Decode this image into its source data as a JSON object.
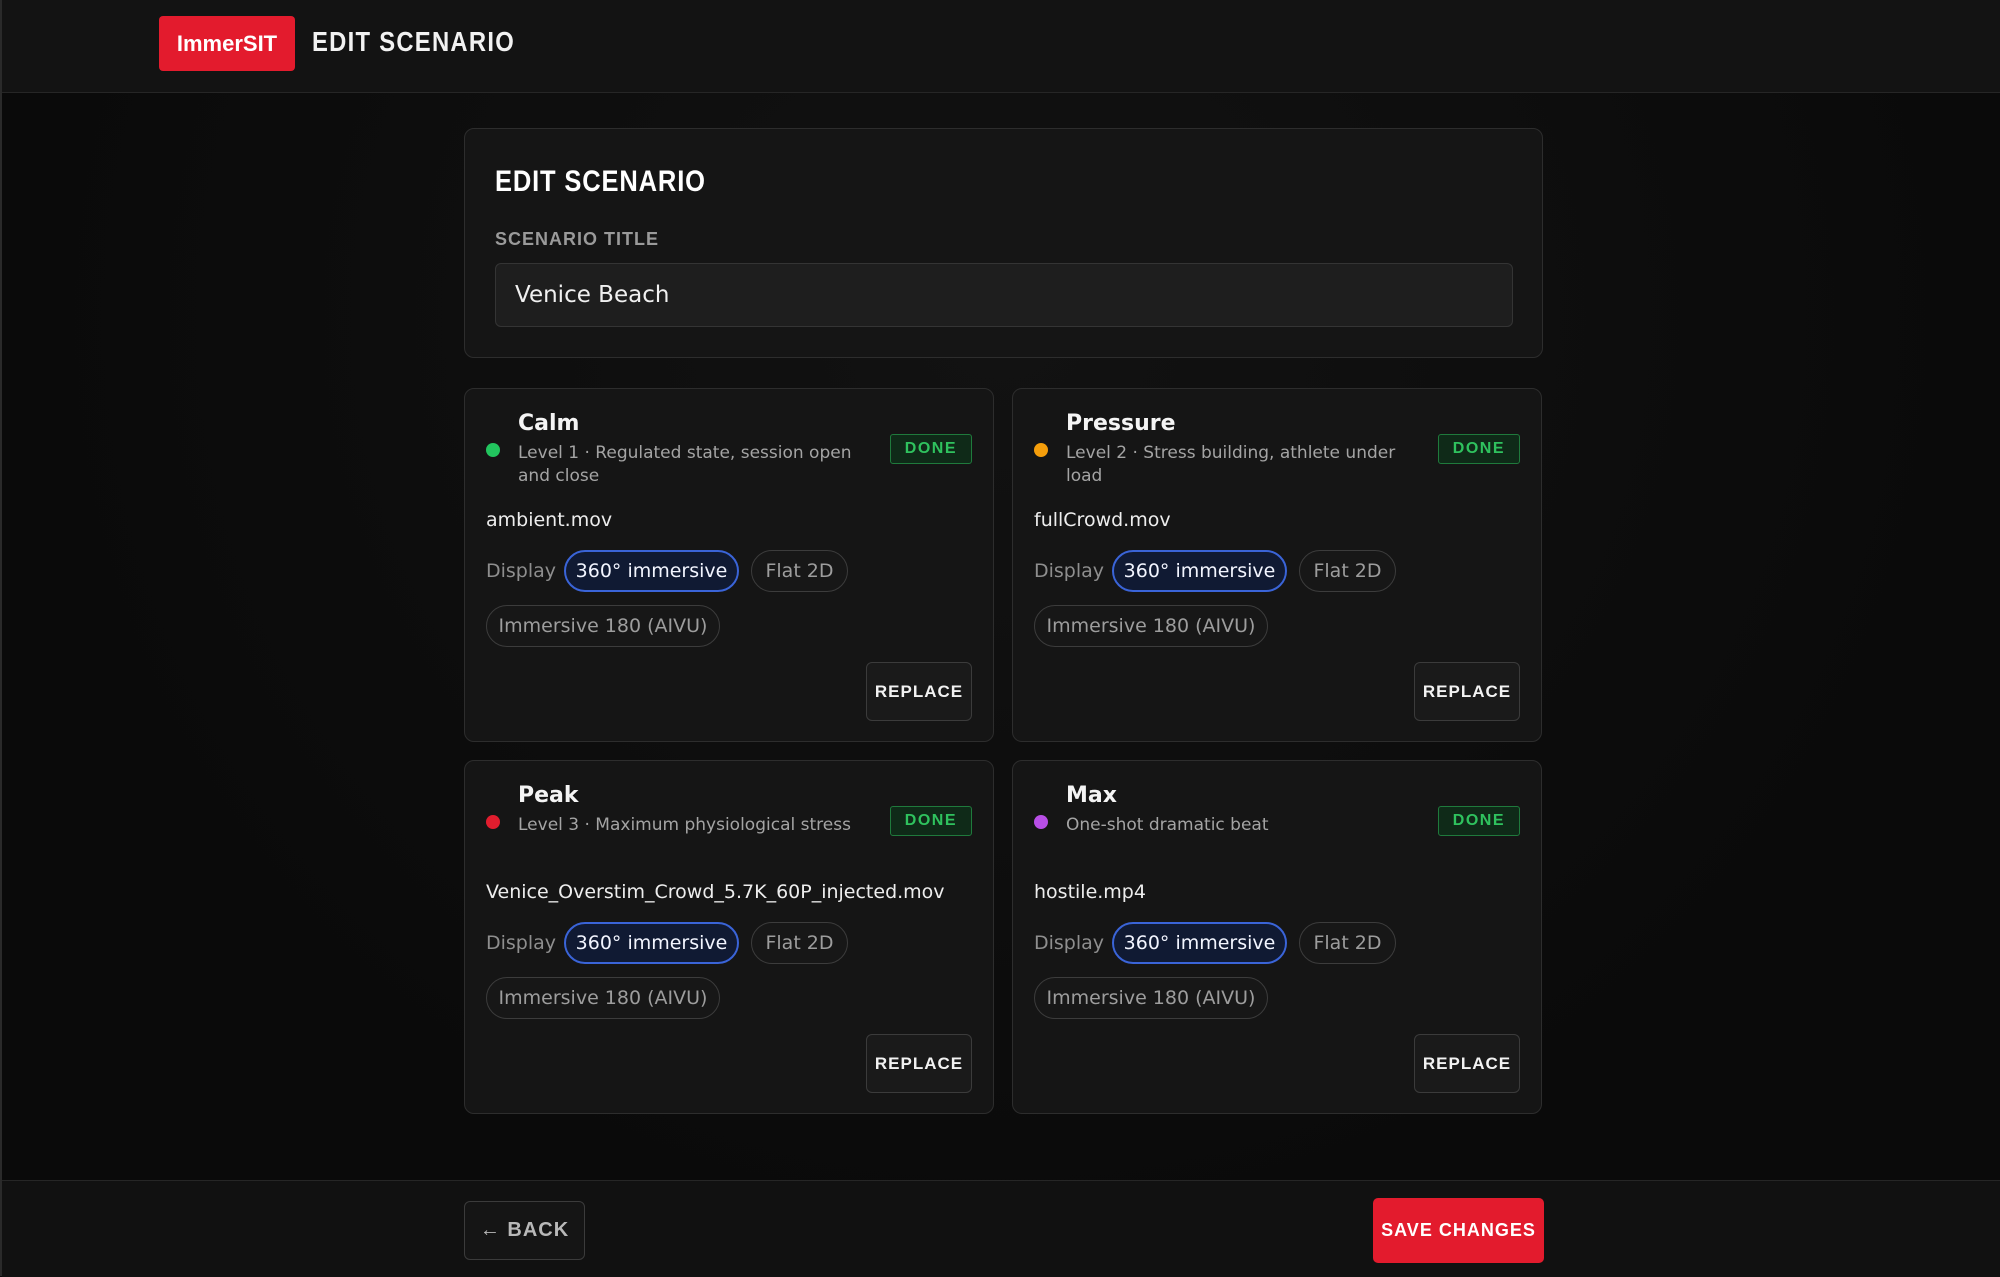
{
  "header": {
    "logo": "ImmerSIT",
    "title": "EDIT SCENARIO"
  },
  "form": {
    "heading": "EDIT SCENARIO",
    "title_label": "SCENARIO TITLE",
    "title_value": "Venice Beach"
  },
  "colors": {
    "accent": "#e31b2d",
    "active_pill_border": "#3a64d8",
    "done_green": "#2fc25e"
  },
  "levels": [
    {
      "name": "Calm",
      "description": "Level 1 · Regulated state, session open and close",
      "status": "DONE",
      "dot_color": "#22c55e",
      "file": "ambient.mov",
      "display_label": "Display",
      "options": [
        "360° immersive",
        "Flat 2D",
        "Immersive 180 (AIVU)"
      ],
      "selected": "360° immersive",
      "replace_label": "REPLACE"
    },
    {
      "name": "Pressure",
      "description": "Level 2 · Stress building, athlete under load",
      "status": "DONE",
      "dot_color": "#f59e0b",
      "file": "fullCrowd.mov",
      "display_label": "Display",
      "options": [
        "360° immersive",
        "Flat 2D",
        "Immersive 180 (AIVU)"
      ],
      "selected": "360° immersive",
      "replace_label": "REPLACE"
    },
    {
      "name": "Peak",
      "description": "Level 3 · Maximum physiological stress",
      "status": "DONE",
      "dot_color": "#e11d2e",
      "file": "Venice_Overstim_Crowd_5.7K_60P_injected.mov",
      "display_label": "Display",
      "options": [
        "360° immersive",
        "Flat 2D",
        "Immersive 180 (AIVU)"
      ],
      "selected": "360° immersive",
      "replace_label": "REPLACE"
    },
    {
      "name": "Max",
      "description": "One-shot dramatic beat",
      "status": "DONE",
      "dot_color": "#b84ee6",
      "file": "hostile.mp4",
      "display_label": "Display",
      "options": [
        "360° immersive",
        "Flat 2D",
        "Immersive 180 (AIVU)"
      ],
      "selected": "360° immersive",
      "replace_label": "REPLACE"
    }
  ],
  "footer": {
    "back_label": "← BACK",
    "save_label": "SAVE CHANGES"
  }
}
